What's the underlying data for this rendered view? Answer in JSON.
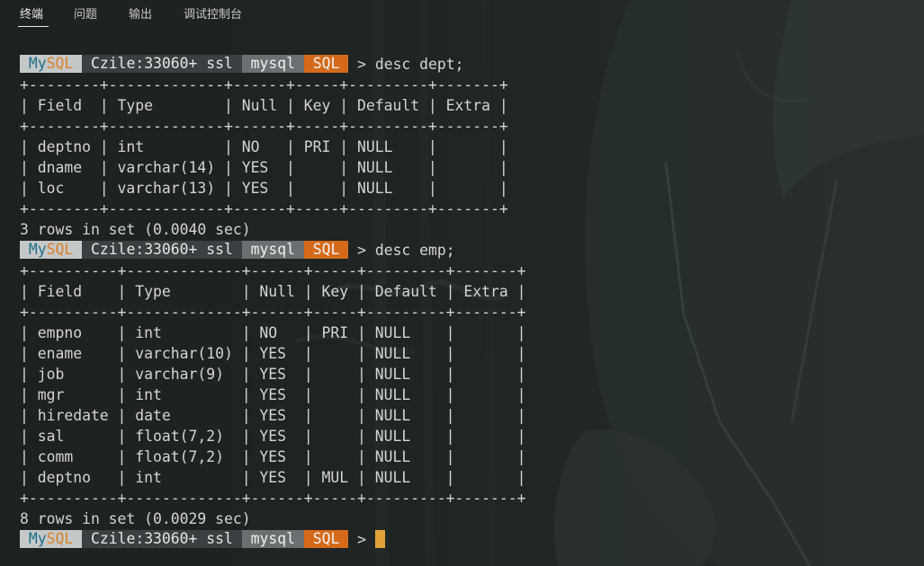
{
  "tabs": [
    {
      "label": "终端",
      "active": true
    },
    {
      "label": "问题",
      "active": false
    },
    {
      "label": "输出",
      "active": false
    },
    {
      "label": "调试控制台",
      "active": false
    }
  ],
  "prompt": {
    "logo_my": "My",
    "logo_sql": "SQL",
    "host": "Czile:33060+ ssl",
    "database": "mysql",
    "language": "SQL",
    "arrow": ">"
  },
  "session": [
    {
      "type": "prompt",
      "command": "desc dept;"
    },
    {
      "type": "text",
      "text": "+--------+-------------+------+-----+---------+-------+"
    },
    {
      "type": "text",
      "text": "| Field  | Type        | Null | Key | Default | Extra |"
    },
    {
      "type": "text",
      "text": "+--------+-------------+------+-----+---------+-------+"
    },
    {
      "type": "text",
      "text": "| deptno | int         | NO   | PRI | NULL    |       |"
    },
    {
      "type": "text",
      "text": "| dname  | varchar(14) | YES  |     | NULL    |       |"
    },
    {
      "type": "text",
      "text": "| loc    | varchar(13) | YES  |     | NULL    |       |"
    },
    {
      "type": "text",
      "text": "+--------+-------------+------+-----+---------+-------+"
    },
    {
      "type": "text",
      "text": "3 rows in set (0.0040 sec)"
    },
    {
      "type": "prompt",
      "command": "desc emp;"
    },
    {
      "type": "text",
      "text": "+----------+-------------+------+-----+---------+-------+"
    },
    {
      "type": "text",
      "text": "| Field    | Type        | Null | Key | Default | Extra |"
    },
    {
      "type": "text",
      "text": "+----------+-------------+------+-----+---------+-------+"
    },
    {
      "type": "text",
      "text": "| empno    | int         | NO   | PRI | NULL    |       |"
    },
    {
      "type": "text",
      "text": "| ename    | varchar(10) | YES  |     | NULL    |       |"
    },
    {
      "type": "text",
      "text": "| job      | varchar(9)  | YES  |     | NULL    |       |"
    },
    {
      "type": "text",
      "text": "| mgr      | int         | YES  |     | NULL    |       |"
    },
    {
      "type": "text",
      "text": "| hiredate | date        | YES  |     | NULL    |       |"
    },
    {
      "type": "text",
      "text": "| sal      | float(7,2)  | YES  |     | NULL    |       |"
    },
    {
      "type": "text",
      "text": "| comm     | float(7,2)  | YES  |     | NULL    |       |"
    },
    {
      "type": "text",
      "text": "| deptno   | int         | YES  | MUL | NULL    |       |"
    },
    {
      "type": "text",
      "text": "+----------+-------------+------+-----+---------+-------+"
    },
    {
      "type": "text",
      "text": "8 rows in set (0.0029 sec)"
    },
    {
      "type": "prompt",
      "command": "",
      "cursor": true
    }
  ],
  "colors": {
    "background": "#1f2322",
    "text": "#d4d4d4",
    "logo_bg": "#c5c8c9",
    "logo_my": "#1e6f88",
    "logo_sql": "#d9822b",
    "host_bg": "#3a3f41",
    "db_bg": "#6b6f71",
    "lang_bg": "#d56a1a",
    "cursor": "#e2a23a"
  }
}
